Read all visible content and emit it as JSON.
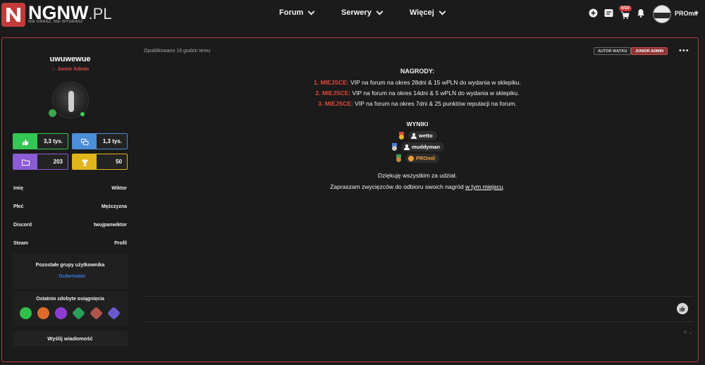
{
  "brand": {
    "name": "NGNW",
    "tld": ".PL",
    "tagline": "NIE GRASZ, NIE WYGRASZ"
  },
  "nav": {
    "items": [
      {
        "label": "Forum"
      },
      {
        "label": "Serwery"
      },
      {
        "label": "Więcej"
      }
    ]
  },
  "topbar": {
    "cart_badge": "0/10",
    "username": "PROmil"
  },
  "author": {
    "username": "uwuwewue",
    "role": "Junior Admin",
    "stats": {
      "likes": "3,3 tys.",
      "posts": "1,3 tys.",
      "files": "203",
      "trophies": "50"
    },
    "info": [
      {
        "key": "Imię",
        "value": "Wiktor"
      },
      {
        "key": "Płeć",
        "value": "Mężczyzna"
      },
      {
        "key": "Discord",
        "value": "twujpanwiktor"
      },
      {
        "key": "Steam",
        "value": "Profil"
      }
    ],
    "groups_title": "Pozostałe grupy użytkownika",
    "group_name": "Gubernator",
    "achievements_title": "Ostatnio zdobyte osiągnięcia",
    "send_message": "Wyślij wiadomość"
  },
  "post": {
    "published": "Opublikowano 16 godzin temu",
    "badge_author": "AUTOR WĄTKU",
    "badge_role": "JUNIOR ADMIN",
    "rewards_title": "NAGRODY:",
    "rewards": [
      {
        "place": "1. MIEJSCE:",
        "text": " VIP na forum na okres 28dni & 15 wPLN do wydania w sklepiku."
      },
      {
        "place": "2. MIEJSCE:",
        "text": " VIP na forum na okres 14dni & 5 wPLN do wydania w sklepiku."
      },
      {
        "place": "3. MIEJSCE:",
        "text": " VIP na forum na okres 7dni & 25 punktów reputacji na forum."
      }
    ],
    "results_title": "WYNIKI",
    "winners": [
      "wetto",
      "muddyman",
      "PROmil"
    ],
    "thanks": "Dziękuję wszystkim za udział.",
    "invite_prefix": "Zapraszam zwycięzców do odbioru swoich nagród ",
    "invite_link": "w tym miejscu",
    "invite_suffix": "."
  },
  "colors": {
    "accent_red": "#c33b3b",
    "likes_green": "#35c755",
    "posts_blue": "#4c8fd8",
    "files_purple": "#8c5bd6",
    "trophy_gold": "#e0b51c"
  }
}
